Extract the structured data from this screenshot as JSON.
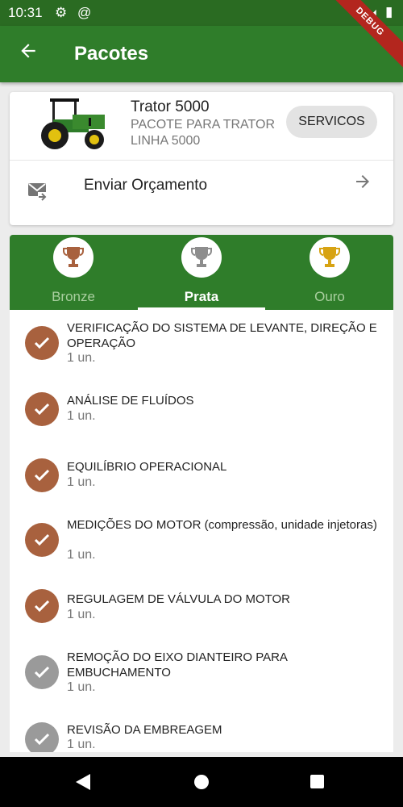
{
  "status_bar": {
    "time": "10:31",
    "icons": [
      "gear-icon",
      "at-icon",
      "wifi-icon",
      "signal-icon",
      "battery-icon"
    ]
  },
  "debug_banner": "DEBUG",
  "app_bar": {
    "title": "Pacotes",
    "back_icon": "arrow-back-icon"
  },
  "package": {
    "name": "Trator 5000",
    "description": "PACOTE PARA TRATOR LINHA 5000",
    "image": "tractor-image",
    "services_button": "SERVICOS"
  },
  "send_quote": {
    "label": "Enviar Orçamento",
    "icon": "mail-forward-icon",
    "arrow": "arrow-forward-icon"
  },
  "tabs": [
    {
      "label": "Bronze",
      "icon": "trophy-icon",
      "icon_color": "#a8613e",
      "active": false
    },
    {
      "label": "Prata",
      "icon": "trophy-icon",
      "icon_color": "#8d8d8d",
      "active": true
    },
    {
      "label": "Ouro",
      "icon": "trophy-icon",
      "icon_color": "#d7a313",
      "active": false
    }
  ],
  "items": [
    {
      "text": "VERIFICAÇÃO DO SISTEMA DE LEVANTE, DIREÇÃO E OPERAÇÃO",
      "qty": "1 un.",
      "status": "done"
    },
    {
      "text": "ANÁLISE DE FLUÍDOS",
      "qty": "1 un.",
      "status": "done"
    },
    {
      "text": "EQUILÍBRIO OPERACIONAL",
      "qty": "1 un.",
      "status": "done"
    },
    {
      "text": "MEDIÇÕES DO MOTOR (compressão, unidade injetoras)",
      "qty": "1 un.",
      "status": "done"
    },
    {
      "text": "REGULAGEM DE VÁLVULA DO MOTOR",
      "qty": "1 un.",
      "status": "done"
    },
    {
      "text": "REMOÇÃO DO EIXO DIANTEIRO PARA EMBUCHAMENTO",
      "qty": "1 un.",
      "status": "pending"
    },
    {
      "text": "REVISÃO DA EMBREAGEM",
      "qty": "1 un.",
      "status": "pending"
    }
  ],
  "colors": {
    "primary": "#2f7d2a",
    "status_bar": "#2a6b22",
    "done": "#a8613e",
    "pending": "#9a9a9a"
  }
}
